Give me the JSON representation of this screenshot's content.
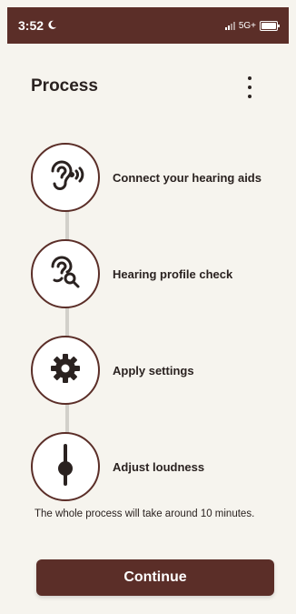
{
  "status_bar": {
    "time": "3:52",
    "network": "5G+"
  },
  "header": {
    "title": "Process"
  },
  "steps": [
    {
      "label": "Connect your hearing aids",
      "icon": "ear-sound-icon"
    },
    {
      "label": "Hearing profile check",
      "icon": "ear-search-icon"
    },
    {
      "label": "Apply settings",
      "icon": "gear-icon"
    },
    {
      "label": "Adjust loudness",
      "icon": "slider-icon"
    }
  ],
  "footer": {
    "duration_text": "The whole process will take around 10 minutes.",
    "continue_label": "Continue"
  },
  "colors": {
    "accent": "#5b2e28",
    "background": "#f6f4ee"
  }
}
